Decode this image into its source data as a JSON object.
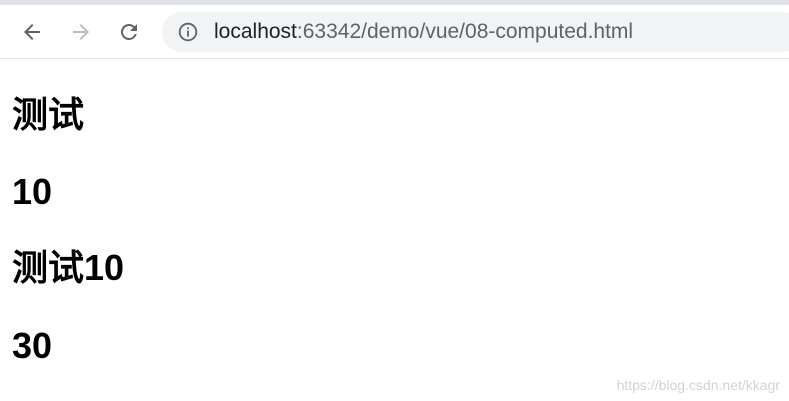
{
  "browser": {
    "url_host": "localhost",
    "url_path": ":63342/demo/vue/08-computed.html",
    "icons": {
      "back": "arrow-left-icon",
      "forward": "arrow-right-icon",
      "reload": "reload-icon",
      "info": "info-circle-icon"
    },
    "colors": {
      "toolbar_bg": "#ffffff",
      "omnibox_bg": "#f1f3f4",
      "icon_active": "#5f6368",
      "icon_disabled": "#babcbe"
    }
  },
  "page": {
    "headings": [
      "测试",
      "10",
      "测试10",
      "30"
    ]
  },
  "watermark": "https://blog.csdn.net/kkagr"
}
